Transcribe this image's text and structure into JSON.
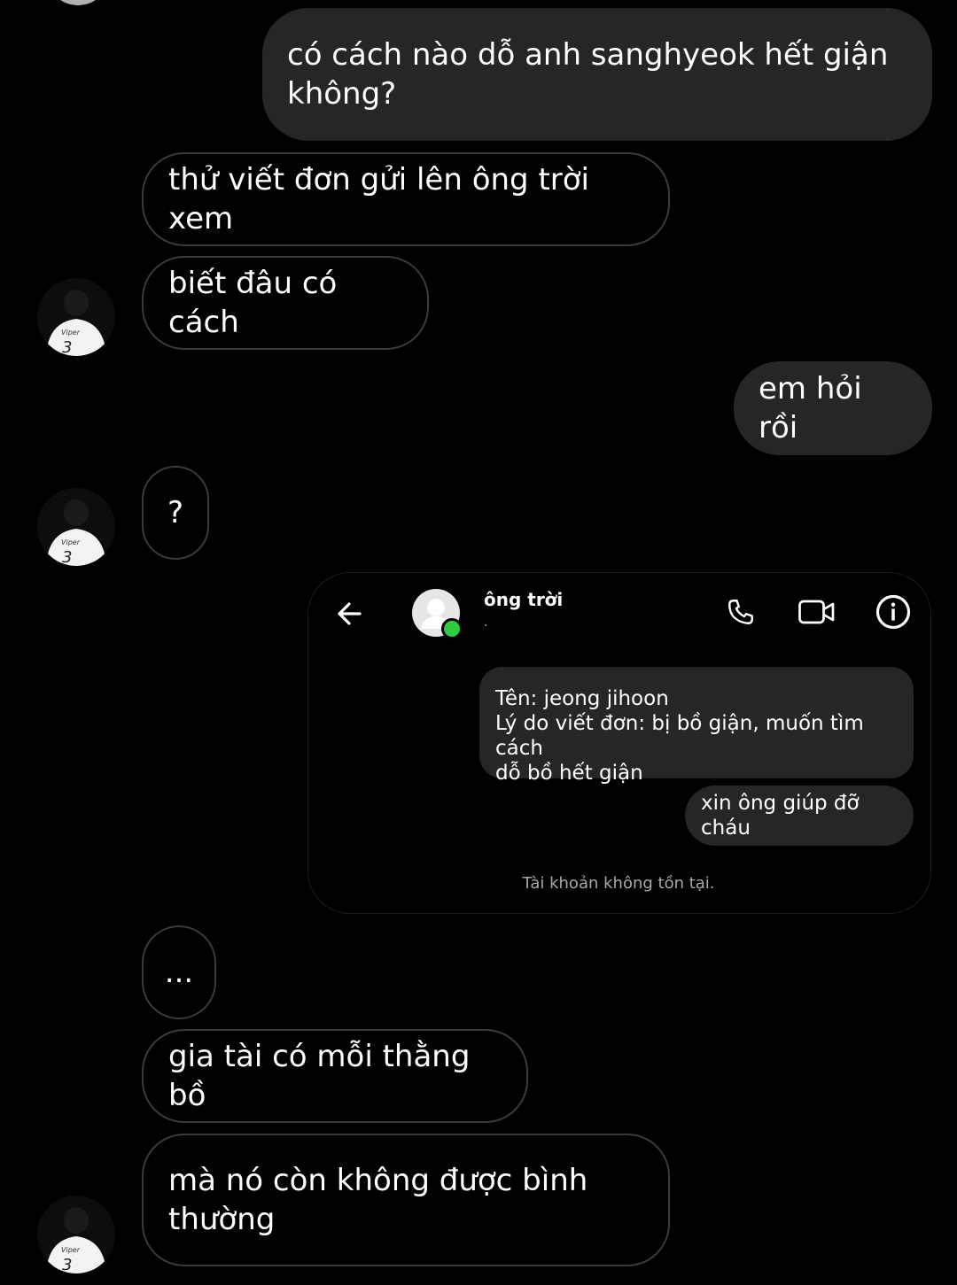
{
  "messages": [
    {
      "side": "out",
      "text": "có cách nào dỗ anh sanghyeok hết giận không?"
    },
    {
      "side": "in",
      "text": "thử viết đơn gửi lên ông trời xem"
    },
    {
      "side": "in",
      "text": "biết đâu có cách"
    },
    {
      "side": "out",
      "text": "em hỏi rồi"
    },
    {
      "side": "in",
      "text": "?"
    },
    {
      "side": "in",
      "text": "..."
    },
    {
      "side": "in",
      "text": "gia tài có mỗi thằng bồ"
    },
    {
      "side": "in",
      "text": "mà nó còn không được bình thường"
    }
  ],
  "contact_avatar": {
    "jersey_name": "Viper",
    "jersey_number": "3"
  },
  "embedded_screenshot": {
    "header": {
      "contact_name": "ông trời",
      "contact_subtitle": ".",
      "icons": [
        "back-arrow-icon",
        "phone-icon",
        "video-call-icon",
        "info-icon"
      ]
    },
    "messages": [
      {
        "side": "out",
        "lines": [
          "Tên: jeong jihoon",
          "Lý do viết đơn: bị bồ giận, muốn tìm cách",
          "dỗ bồ hết giận"
        ]
      },
      {
        "side": "out",
        "lines": [
          "xin ông giúp đỡ cháu"
        ]
      }
    ],
    "footer_notice": "Tài khoản không tồn tại."
  },
  "colors": {
    "background": "#000000",
    "outgoing_bubble": "#262626",
    "incoming_border": "#3a3a3a",
    "online_dot": "#2ecc40"
  }
}
